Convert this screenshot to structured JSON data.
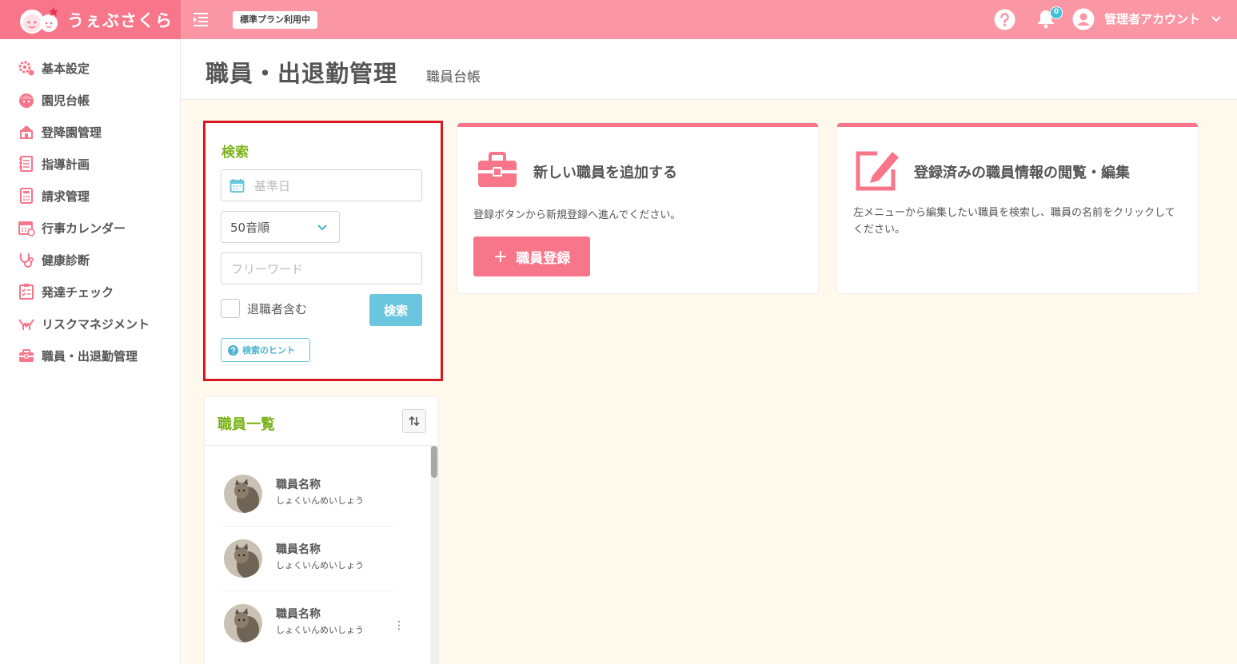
{
  "app": {
    "name": "うぇぶさくら",
    "plan_badge": "標準プラン利用中"
  },
  "header": {
    "notification_count": "0",
    "account_label": "管理者アカウント"
  },
  "sidebar": {
    "items": [
      {
        "label": "基本設定",
        "icon": "gear-icon"
      },
      {
        "label": "園児台帳",
        "icon": "child-icon"
      },
      {
        "label": "登降園管理",
        "icon": "school-icon"
      },
      {
        "label": "指導計画",
        "icon": "notebook-icon"
      },
      {
        "label": "請求管理",
        "icon": "calculator-icon"
      },
      {
        "label": "行事カレンダー",
        "icon": "calendar-icon"
      },
      {
        "label": "健康診断",
        "icon": "stethoscope-icon"
      },
      {
        "label": "発達チェック",
        "icon": "checklist-icon"
      },
      {
        "label": "リスクマネジメント",
        "icon": "hands-heart-icon"
      },
      {
        "label": "職員・出退勤管理",
        "icon": "briefcase-icon"
      }
    ]
  },
  "page": {
    "title": "職員・出退勤管理",
    "subtitle": "職員台帳"
  },
  "search": {
    "title": "検索",
    "date_placeholder": "基準日",
    "sort_value": "50音順",
    "free_word_placeholder": "フリーワード",
    "retired_label": "退職者含む",
    "retired_checked": false,
    "search_button": "検索",
    "hint_button": "検索のヒント"
  },
  "staff_list": {
    "title": "職員一覧",
    "rows": [
      {
        "name": "職員名称",
        "kana": "しょくいんめいしょう"
      },
      {
        "name": "職員名称",
        "kana": "しょくいんめいしょう"
      },
      {
        "name": "職員名称",
        "kana": "しょくいんめいしょう"
      }
    ]
  },
  "cards": {
    "add": {
      "title": "新しい職員を追加する",
      "description": "登録ボタンから新規登録へ進んでください。",
      "button": "職員登録",
      "button_icon": "plus-icon"
    },
    "edit": {
      "title": "登録済みの職員情報の閲覧・編集",
      "description": "左メニューから編集したい職員を検索し、職員の名前をクリックしてください。"
    }
  },
  "colors": {
    "brand_pink": "#f7768a",
    "topbar_pink": "#fb97a5",
    "accent_green": "#7ab317",
    "accent_blue": "#6ac6de",
    "highlight_red": "#d7191f"
  }
}
